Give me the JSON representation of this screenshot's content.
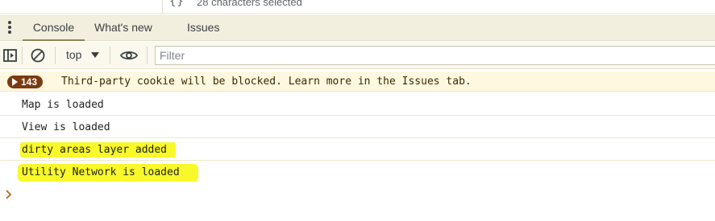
{
  "status": {
    "braces": "{}",
    "text": "28 characters selected"
  },
  "drawer": {
    "tabs": [
      {
        "label": "Console",
        "active": true
      },
      {
        "label": "What's new",
        "active": false
      },
      {
        "label": "Issues",
        "active": false
      }
    ]
  },
  "toolbar": {
    "sidebar_icon": "sidebar-toggle-icon",
    "clear_icon": "clear-console-icon",
    "context": "top",
    "eye_icon": "eye-icon",
    "filter_placeholder": "Filter"
  },
  "console": {
    "issues_badge": "143",
    "warning": "Third-party cookie will be blocked. Learn more in the Issues tab.",
    "messages": [
      {
        "text": "Map is loaded",
        "highlighted": false
      },
      {
        "text": "View is loaded",
        "highlighted": false
      },
      {
        "text": "dirty areas layer added",
        "highlighted": true
      },
      {
        "text": "Utility Network is loaded",
        "highlighted": true
      }
    ],
    "prompt_icon": "chevron-right-icon"
  },
  "colors": {
    "tabbar": "#f2efde",
    "toolbar": "#fbf9ee",
    "warning_bg": "#fff8e0",
    "badge": "#7b3a0f",
    "highlight": "#f9f82a"
  }
}
